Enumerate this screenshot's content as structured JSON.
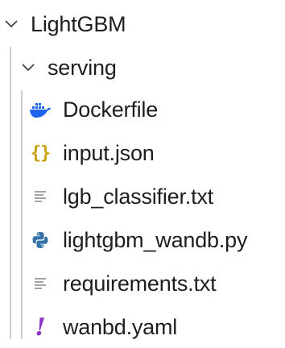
{
  "explorer": {
    "root": {
      "label": "LightGBM",
      "expanded": true,
      "icon": "chevron-down-icon"
    },
    "folder": {
      "label": "serving",
      "expanded": true,
      "icon": "chevron-down-icon"
    },
    "files": [
      {
        "label": "Dockerfile",
        "icon": "docker-icon"
      },
      {
        "label": "input.json",
        "icon": "json-braces-icon"
      },
      {
        "label": "lgb_classifier.txt",
        "icon": "text-lines-icon"
      },
      {
        "label": "lightgbm_wandb.py",
        "icon": "python-icon"
      },
      {
        "label": "requirements.txt",
        "icon": "text-lines-icon"
      },
      {
        "label": "wanbd.yaml",
        "icon": "yaml-exclamation-icon"
      }
    ]
  },
  "colors": {
    "docker": "#1d63ed",
    "json": "#c9a20a",
    "python": "#3572a5",
    "yaml": "#8c2fc6",
    "text_icon": "#9a9a9a",
    "guide": "#cfcfcf"
  }
}
